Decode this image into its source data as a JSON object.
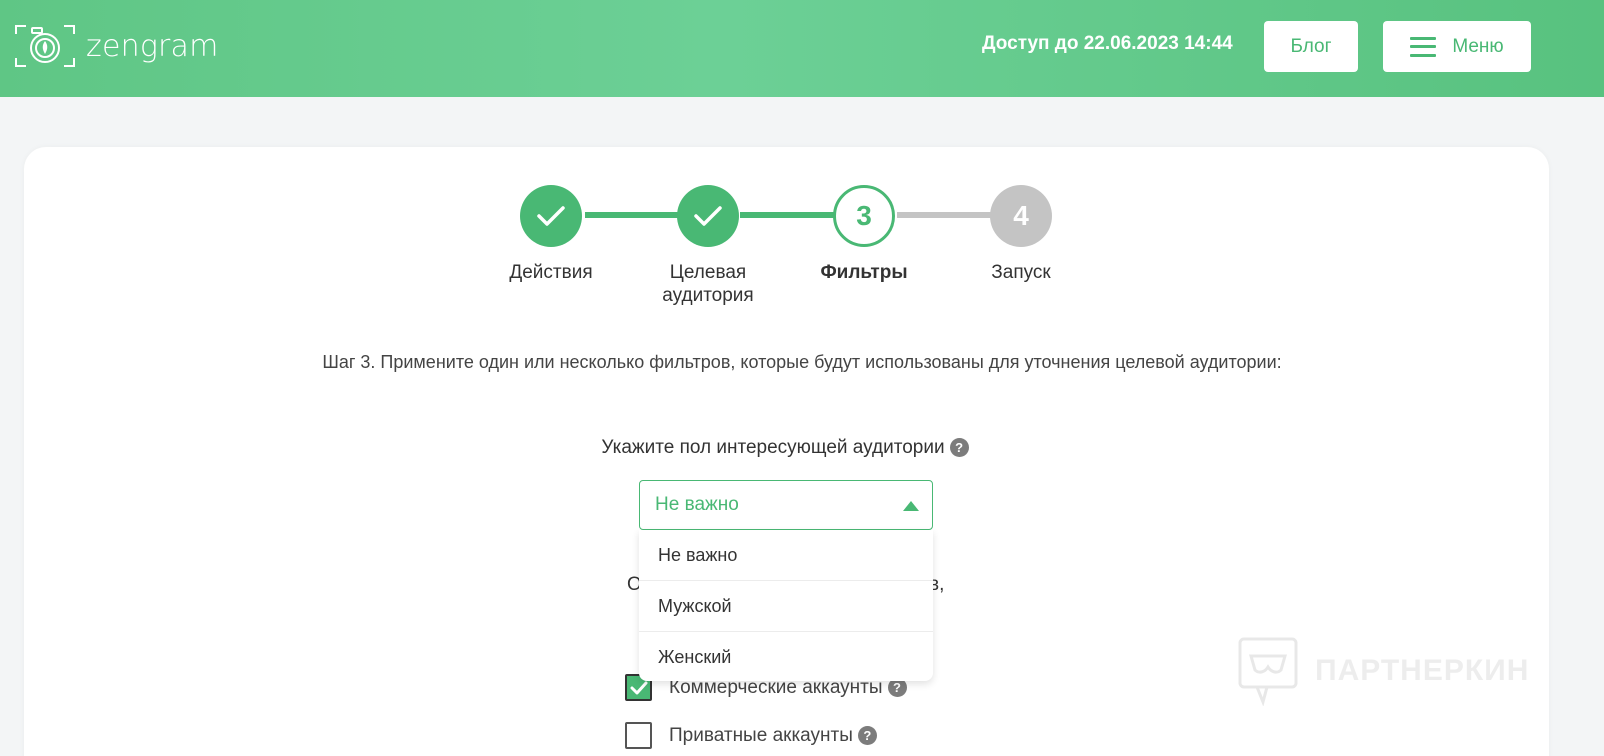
{
  "header": {
    "logo_text": "zengram",
    "access_text": "Доступ до 22.06.2023 14:44",
    "blog_label": "Блог",
    "menu_label": "Меню"
  },
  "steps": [
    {
      "label": "Действия",
      "state": "done"
    },
    {
      "label": "Целевая аудитория",
      "state": "done"
    },
    {
      "label": "Фильтры",
      "number": "3",
      "state": "current"
    },
    {
      "label": "Запуск",
      "number": "4",
      "state": "pending"
    }
  ],
  "instruction": "Шаг 3. Примените один или несколько фильтров, которые будут использованы для уточнения целевой аудитории:",
  "gender": {
    "label": "Укажите пол интересующей аудитории",
    "help": "?",
    "selected": "Не важно",
    "options": [
      "Не важно",
      "Мужской",
      "Женский"
    ]
  },
  "obscured": {
    "start": "О",
    "end": "в,"
  },
  "account_filters": [
    {
      "label": "Коммерческие аккаунты",
      "checked": true
    },
    {
      "label": "Приватные аккаунты",
      "checked": false
    }
  ],
  "watermark": "ПАРТНЕРКИН",
  "colors": {
    "accent": "#49b874",
    "header_start": "#5fc685",
    "header_end": "#58c27f",
    "pending": "#c4c4c4",
    "card_bg": "#ffffff",
    "page_bg": "#f3f5f6"
  }
}
